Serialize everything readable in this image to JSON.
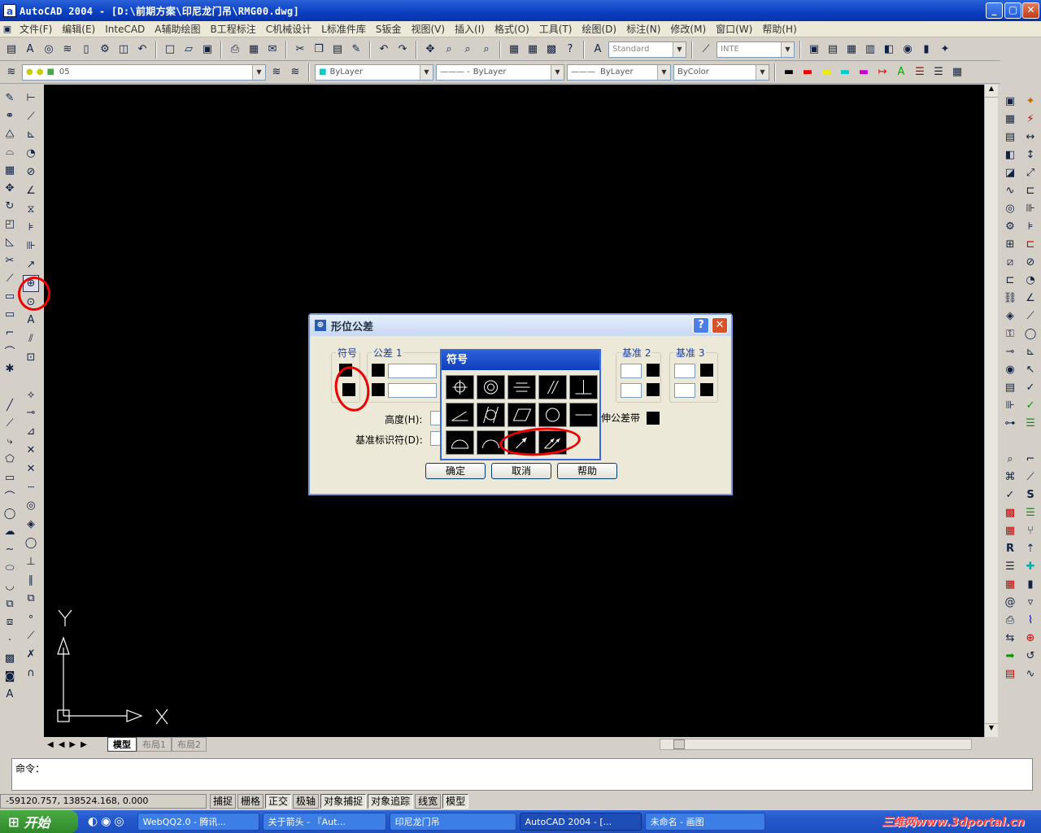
{
  "window": {
    "title": "AutoCAD 2004 - [D:\\前期方案\\印尼龙门吊\\RMG00.dwg]",
    "app_icon": "a",
    "controls": {
      "minimize": "_",
      "restore": "▢",
      "close": "✕"
    }
  },
  "menubar": [
    "文件(F)",
    "编辑(E)",
    "InteCAD",
    "A辅助绘图",
    "B工程标注",
    "C机械设计",
    "L标准件库",
    "S钣金",
    "视图(V)",
    "插入(I)",
    "格式(O)",
    "工具(T)",
    "绘图(D)",
    "标注(N)",
    "修改(M)",
    "窗口(W)",
    "帮助(H)"
  ],
  "toolbar_standard": {
    "text_style": "Standard",
    "dim_style": "INTE"
  },
  "toolbar_layers": {
    "layer": "05",
    "color": "ByLayer",
    "linetype": "ByLayer",
    "lineweight": "ByLayer",
    "plotstyle": "ByColor"
  },
  "ucs": {
    "y_label": "Y",
    "x_label": "X"
  },
  "layout_tabs": [
    "模型",
    "布局1",
    "布局2"
  ],
  "command": {
    "prompt": "命令："
  },
  "statusbar": {
    "coords": "-59120.757, 138524.168, 0.000",
    "toggles": [
      {
        "label": "捕捉",
        "on": false
      },
      {
        "label": "栅格",
        "on": false
      },
      {
        "label": "正交",
        "on": true
      },
      {
        "label": "极轴",
        "on": false
      },
      {
        "label": "对象捕捉",
        "on": true
      },
      {
        "label": "对象追踪",
        "on": true
      },
      {
        "label": "线宽",
        "on": false
      },
      {
        "label": "模型",
        "on": true
      }
    ]
  },
  "taskbar": {
    "start": "开始",
    "tasks": [
      "WebQQ2.0 - 腾讯...",
      "关于箭头 - 『Aut...",
      "印尼龙门吊",
      "AutoCAD 2004 - [...",
      "未命名 - 画图"
    ],
    "watermark": "三维网www.3dportal.cn"
  },
  "dialog": {
    "title": "形位公差",
    "help_btn": "?",
    "close_btn": "✕",
    "labels": {
      "symbol": "符号",
      "tolerance1": "公差 1",
      "datum2": "基准 2",
      "datum3": "基准 3",
      "height": "高度(H):",
      "datum_id": "基准标识符(D):",
      "projected": "延伸公差带:"
    },
    "buttons": {
      "ok": "确定",
      "cancel": "取消",
      "help": "帮助"
    }
  },
  "symbol_popup": {
    "title": "符号",
    "symbols": [
      "position-symbol",
      "concentricity-symbol",
      "symmetry-symbol",
      "parallelism-symbol",
      "perpendicularity-symbol",
      "angularity-symbol",
      "cylindricity-symbol",
      "flatness-symbol",
      "circularity-symbol",
      "straightness-symbol",
      "surface-profile-symbol",
      "line-profile-symbol",
      "circular-runout-symbol",
      "total-runout-symbol"
    ]
  },
  "colors": {
    "titlebar": "#0a3fc0",
    "canvas": "#000000",
    "annotation": "#e00000",
    "dialog_bg": "#ece9d8"
  }
}
